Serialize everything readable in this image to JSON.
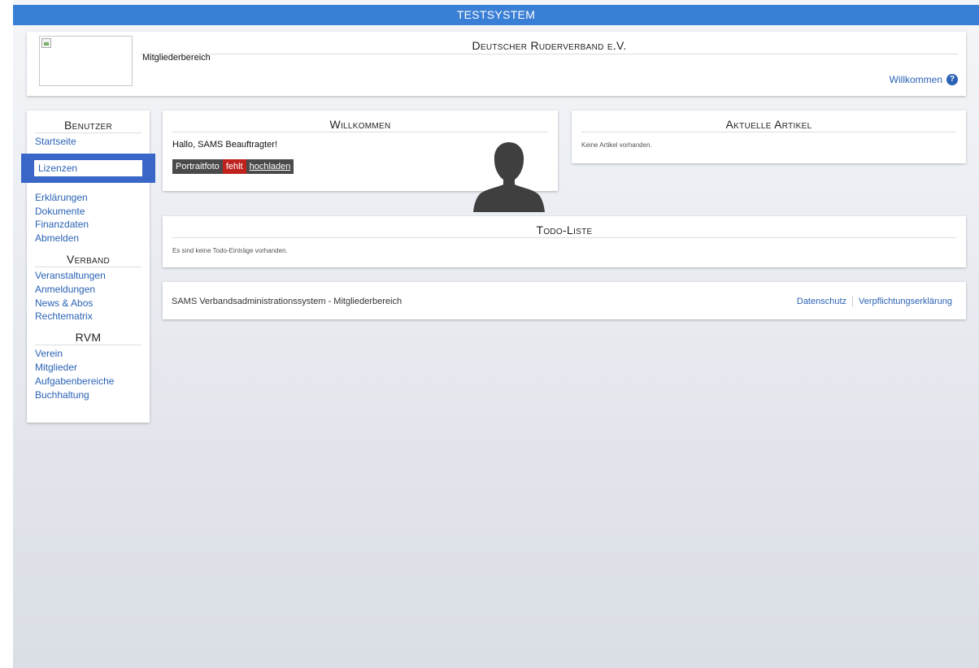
{
  "topbar": {
    "label": "TESTSYSTEM"
  },
  "header": {
    "org_name": "Deutscher Ruderverband e.V.",
    "subtitle": "Mitgliederbereich",
    "welcome_link": "Willkommen",
    "help_icon": "question-circle-icon"
  },
  "sidebar": {
    "sections": [
      {
        "heading": "Benutzer",
        "items": [
          "Startseite",
          "Lizenzen",
          "Erklärungen",
          "Dokumente",
          "Finanzdaten",
          "Abmelden"
        ]
      },
      {
        "heading": "Verband",
        "items": [
          "Veranstaltungen",
          "Anmeldungen",
          "News & Abos",
          "Rechtematrix"
        ]
      },
      {
        "heading": "RVM",
        "items": [
          "Verein",
          "Mitglieder",
          "Aufgabenbereiche",
          "Buchhaltung"
        ]
      }
    ],
    "highlight_color": "#3a67c7"
  },
  "welcome": {
    "title": "Willkommen",
    "greeting": "Hallo, SAMS Beauftragter!",
    "photo_label": "Portraitfoto",
    "photo_status": "fehlt",
    "photo_action": "hochladen",
    "avatar_icon": "user-silhouette-icon"
  },
  "articles": {
    "title": "Aktuelle Artikel",
    "empty_text": "Keine Artikel vorhanden."
  },
  "todo": {
    "title": "Todo-Liste",
    "empty_text": "Es sind keine Todo-Einträge vorhanden."
  },
  "footer": {
    "text": "SAMS Verbandsadministrationssystem - Mitgliederbereich",
    "links": [
      "Datenschutz",
      "Verpflichtungserklärung"
    ]
  },
  "colors": {
    "topbar": "#3a7fd6",
    "link": "#2a62b5",
    "missing": "#c0231e"
  }
}
